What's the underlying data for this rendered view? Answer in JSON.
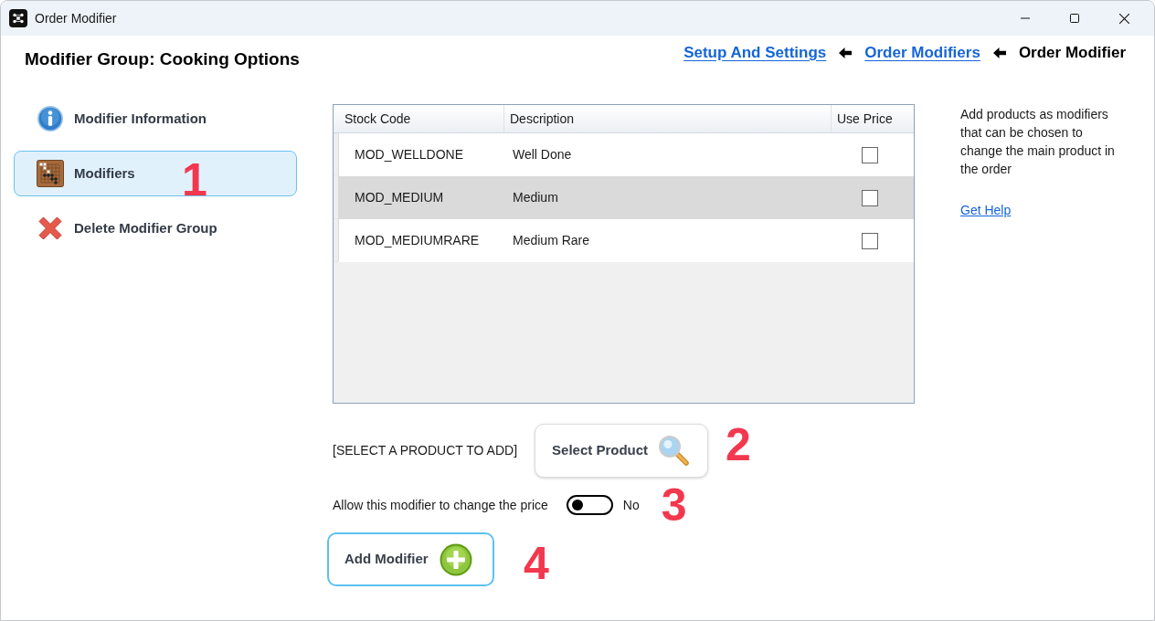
{
  "window": {
    "title": "Order Modifier"
  },
  "header": {
    "title": "Modifier Group: Cooking Options"
  },
  "breadcrumb": [
    {
      "label": "Setup And Settings",
      "kind": "link"
    },
    {
      "label": "Order Modifiers",
      "kind": "link"
    },
    {
      "label": "Order Modifier",
      "kind": "current"
    }
  ],
  "sidebar": {
    "items": [
      {
        "label": "Modifier Information",
        "kind": "info",
        "selected": false
      },
      {
        "label": "Modifiers",
        "kind": "board",
        "selected": true,
        "annotation": "1"
      },
      {
        "label": "Delete Modifier Group",
        "kind": "delete",
        "selected": false
      }
    ]
  },
  "table": {
    "columns": [
      "Stock Code",
      "Description",
      "Use Price"
    ],
    "rows": [
      {
        "stock_code": "MOD_WELLDONE",
        "description": "Well Done",
        "use_price": false,
        "selected": false
      },
      {
        "stock_code": "MOD_MEDIUM",
        "description": "Medium",
        "use_price": false,
        "selected": true
      },
      {
        "stock_code": "MOD_MEDIUMRARE",
        "description": "Medium Rare",
        "use_price": false,
        "selected": false
      }
    ]
  },
  "product_select": {
    "label": "[SELECT A PRODUCT TO ADD]",
    "button": "Select Product",
    "annotation": "2"
  },
  "price_toggle": {
    "label": "Allow this modifier to change the price",
    "on": false,
    "state_text": "No",
    "annotation": "3"
  },
  "add_button": {
    "label": "Add Modifier",
    "annotation": "4"
  },
  "help": {
    "text": "Add products as modifiers that can be chosen to change the main product in the order",
    "link": "Get Help"
  }
}
